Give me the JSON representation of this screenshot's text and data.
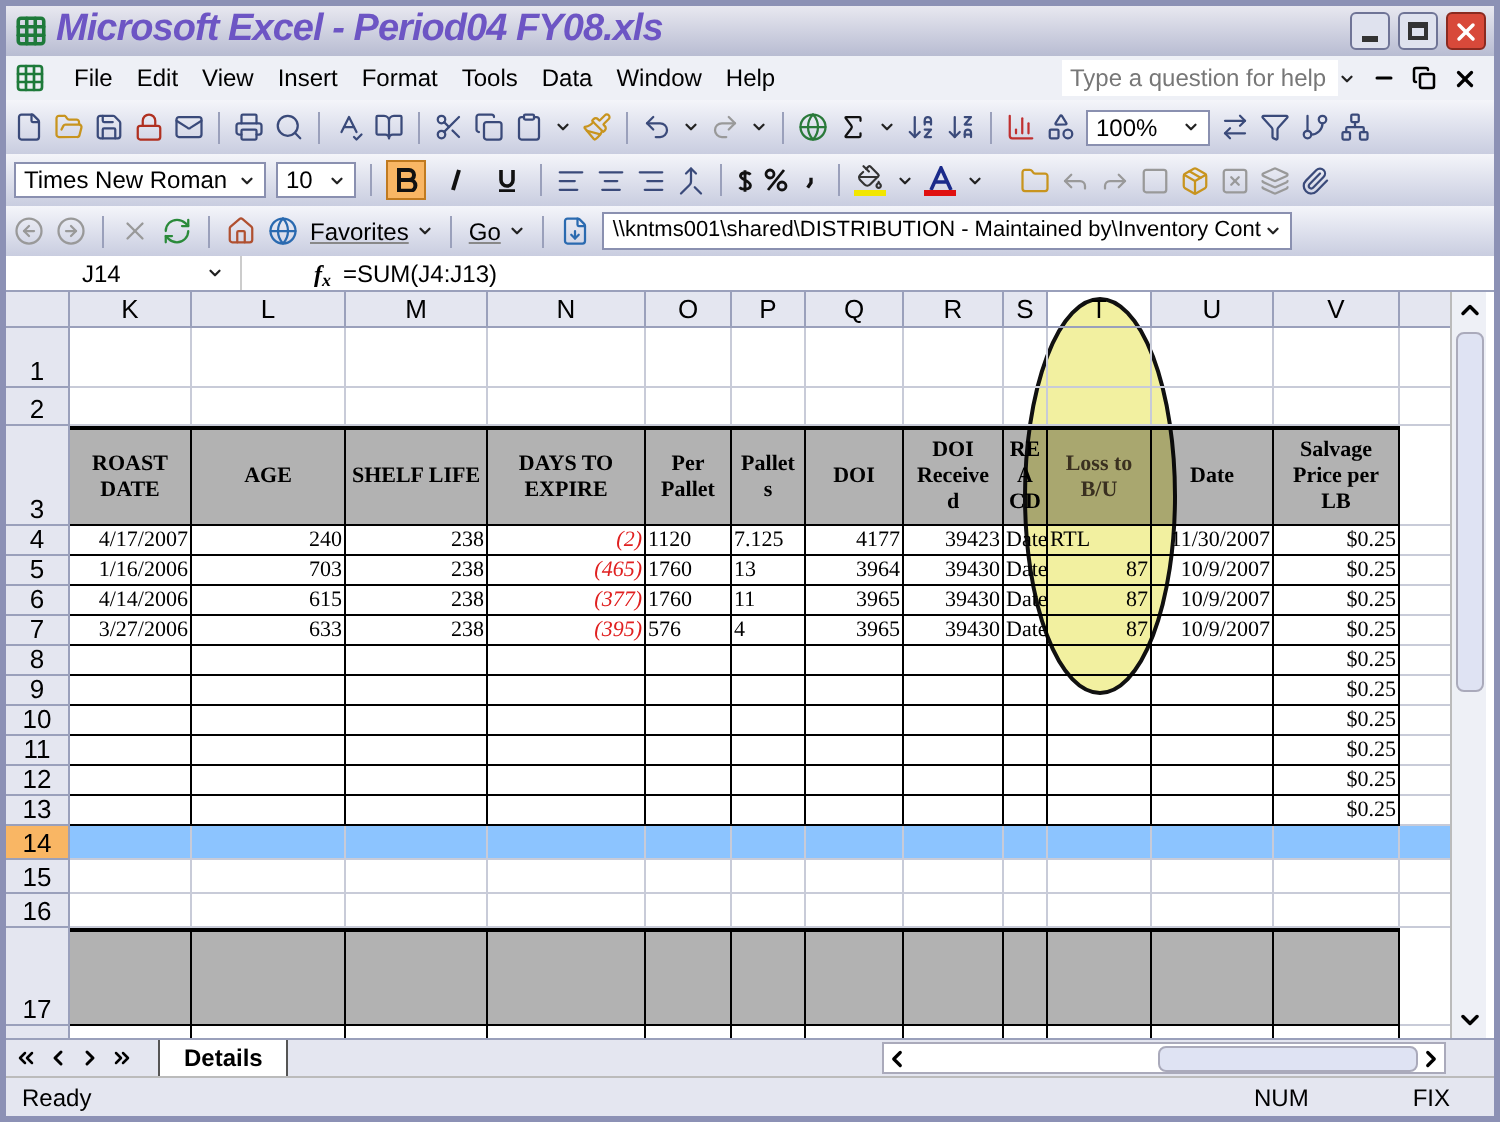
{
  "window": {
    "title": "Microsoft Excel - Period04 FY08.xls"
  },
  "menu": [
    {
      "label": "File"
    },
    {
      "label": "Edit"
    },
    {
      "label": "View"
    },
    {
      "label": "Insert"
    },
    {
      "label": "Format"
    },
    {
      "label": "Tools"
    },
    {
      "label": "Data"
    },
    {
      "label": "Window"
    },
    {
      "label": "Help"
    }
  ],
  "help_box": {
    "placeholder": "Type a question for help"
  },
  "standard_toolbar": {
    "zoom": "100%"
  },
  "formatting_toolbar": {
    "font": "Times New Roman",
    "size": "10",
    "bold": true,
    "italic": false,
    "underline": false
  },
  "web_toolbar": {
    "favorites": "Favorites",
    "go": "Go",
    "address": "\\\\kntms001\\shared\\DISTRIBUTION - Maintained by\\Inventory Cont"
  },
  "formula_bar": {
    "name_box": "J14",
    "function_label": "f$_{x}$",
    "formula": "=SUM(J4:J13)"
  },
  "columns": [
    "K",
    "L",
    "M",
    "N",
    "O",
    "P",
    "Q",
    "R",
    "S",
    "T",
    "U",
    "V"
  ],
  "rows": [
    {
      "number": "1",
      "kind": "blank",
      "selected": false
    },
    {
      "number": "2",
      "kind": "blank",
      "selected": false
    },
    {
      "number": "3",
      "kind": "header",
      "selected": false,
      "cells": {
        "K": [
          "ROAST",
          "DATE"
        ],
        "L": [
          "AGE"
        ],
        "M": [
          "SHELF LIFE"
        ],
        "N": [
          "DAYS TO",
          "EXPIRE"
        ],
        "O": [
          "Per",
          "Pallet"
        ],
        "P": [
          "Pallet",
          "s"
        ],
        "Q": [
          "DOI"
        ],
        "R": [
          "DOI",
          "Receive",
          "d"
        ],
        "S": [
          "RE",
          "A",
          "CD"
        ],
        "T": [
          "Loss to",
          "B/U"
        ],
        "U": [
          "Date"
        ],
        "V": [
          "Salvage",
          "Price per",
          "LB"
        ]
      }
    },
    {
      "number": "4",
      "kind": "data",
      "selected": false,
      "negative": true,
      "cells": {
        "K": "4/17/2007",
        "L": "240",
        "M": "238",
        "N": "(2)",
        "O": "1120",
        "P": "7.125",
        "Q": "4177",
        "R": "39423",
        "S": "Date",
        "T": "RTL",
        "U": "11/30/2007",
        "V": "$0.25"
      }
    },
    {
      "number": "5",
      "kind": "data",
      "selected": false,
      "negative": true,
      "cells": {
        "K": "1/16/2006",
        "L": "703",
        "M": "238",
        "N": "(465)",
        "O": "1760",
        "P": "13",
        "Q": "3964",
        "R": "39430",
        "S": "Date",
        "T": "87",
        "U": "10/9/2007",
        "V": "$0.25"
      }
    },
    {
      "number": "6",
      "kind": "data",
      "selected": false,
      "negative": true,
      "cells": {
        "K": "4/14/2006",
        "L": "615",
        "M": "238",
        "N": "(377)",
        "O": "1760",
        "P": "11",
        "Q": "3965",
        "R": "39430",
        "S": "Date",
        "T": "87",
        "U": "10/9/2007",
        "V": "$0.25"
      }
    },
    {
      "number": "7",
      "kind": "data",
      "selected": false,
      "negative": true,
      "cells": {
        "K": "3/27/2006",
        "L": "633",
        "M": "238",
        "N": "(395)",
        "O": "576",
        "P": "4",
        "Q": "3965",
        "R": "39430",
        "S": "Date",
        "T": "87",
        "U": "10/9/2007",
        "V": "$0.25"
      }
    },
    {
      "number": "8",
      "kind": "data",
      "selected": false,
      "cells": {
        "V": "$0.25"
      }
    },
    {
      "number": "9",
      "kind": "data",
      "selected": false,
      "cells": {
        "V": "$0.25"
      }
    },
    {
      "number": "10",
      "kind": "data",
      "selected": false,
      "cells": {
        "V": "$0.25"
      }
    },
    {
      "number": "11",
      "kind": "data",
      "selected": false,
      "cells": {
        "V": "$0.25"
      }
    },
    {
      "number": "12",
      "kind": "data",
      "selected": false,
      "cells": {
        "V": "$0.25"
      }
    },
    {
      "number": "13",
      "kind": "data",
      "selected": false,
      "cells": {
        "V": "$0.25"
      }
    },
    {
      "number": "14",
      "kind": "blank",
      "selected": true
    },
    {
      "number": "15",
      "kind": "blank",
      "selected": false
    },
    {
      "number": "16",
      "kind": "blank",
      "selected": false
    },
    {
      "number": "17",
      "kind": "band",
      "selected": false
    }
  ],
  "sheet_tabs": [
    {
      "label": "Details",
      "selected": true
    }
  ],
  "status_bar": {
    "status": "Ready",
    "num": "NUM",
    "fix": "FIX"
  }
}
